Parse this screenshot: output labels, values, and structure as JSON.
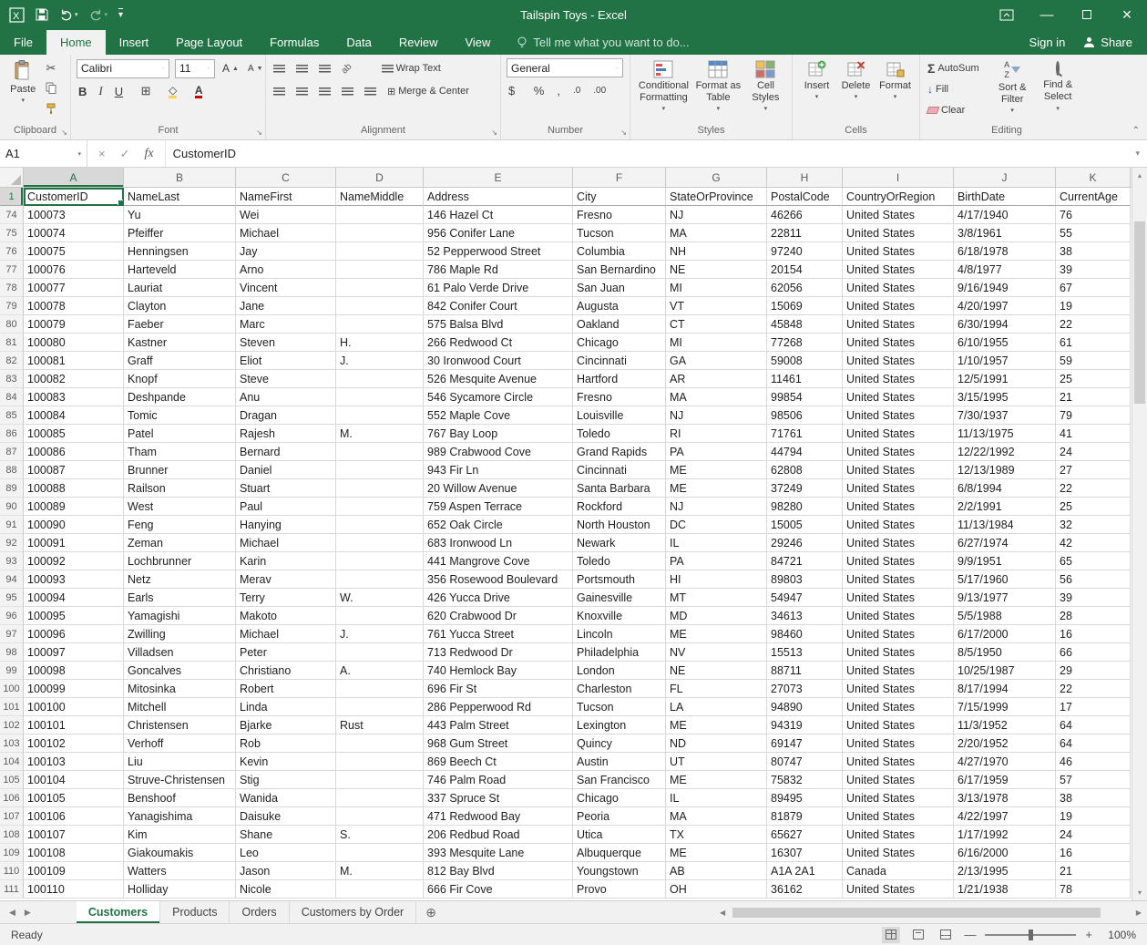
{
  "title_bar": {
    "title": "Tailspin Toys - Excel"
  },
  "ribbon": {
    "tabs": [
      {
        "label": "File",
        "active": false
      },
      {
        "label": "Home",
        "active": true
      },
      {
        "label": "Insert",
        "active": false
      },
      {
        "label": "Page Layout",
        "active": false
      },
      {
        "label": "Formulas",
        "active": false
      },
      {
        "label": "Data",
        "active": false
      },
      {
        "label": "Review",
        "active": false
      },
      {
        "label": "View",
        "active": false
      }
    ],
    "tell_me": "Tell me what you want to do...",
    "sign_in": "Sign in",
    "share": "Share",
    "clipboard": {
      "label": "Clipboard",
      "paste": "Paste"
    },
    "font": {
      "label": "Font",
      "font_name": "Calibri",
      "font_size": "11",
      "bold": "B",
      "italic": "I",
      "underline": "U",
      "grow": "A",
      "shrink": "A",
      "color_label": "A"
    },
    "alignment": {
      "label": "Alignment",
      "wrap_text": "Wrap Text",
      "merge_center": "Merge & Center"
    },
    "number": {
      "label": "Number",
      "format": "General",
      "currency": "$",
      "percent": "%",
      "comma": ",",
      "inc_decimal": ".0",
      "dec_decimal": ".00"
    },
    "styles": {
      "label": "Styles",
      "conditional": "Conditional Formatting",
      "format_table": "Format as Table",
      "cell_styles": "Cell Styles"
    },
    "cells": {
      "label": "Cells",
      "insert": "Insert",
      "delete": "Delete",
      "format": "Format"
    },
    "editing": {
      "label": "Editing",
      "autosum": "AutoSum",
      "fill": "Fill",
      "clear": "Clear",
      "sort": "Sort & Filter",
      "find": "Find & Select"
    }
  },
  "formula_bar": {
    "name_box": "A1",
    "formula": "CustomerID",
    "fx": "fx"
  },
  "grid": {
    "columns": [
      "A",
      "B",
      "C",
      "D",
      "E",
      "F",
      "G",
      "H",
      "I",
      "J",
      "K"
    ],
    "header_row": {
      "n": "1",
      "cells": [
        "CustomerID",
        "NameLast",
        "NameFirst",
        "NameMiddle",
        "Address",
        "City",
        "StateOrProvince",
        "PostalCode",
        "CountryOrRegion",
        "BirthDate",
        "CurrentAge"
      ]
    },
    "rows": [
      {
        "n": "74",
        "cells": [
          "100073",
          "Yu",
          "Wei",
          "",
          "146 Hazel Ct",
          "Fresno",
          "NJ",
          "46266",
          "United States",
          "4/17/1940",
          "76"
        ]
      },
      {
        "n": "75",
        "cells": [
          "100074",
          "Pfeiffer",
          "Michael",
          "",
          "956 Conifer Lane",
          "Tucson",
          "MA",
          "22811",
          "United States",
          "3/8/1961",
          "55"
        ]
      },
      {
        "n": "76",
        "cells": [
          "100075",
          "Henningsen",
          "Jay",
          "",
          "52 Pepperwood Street",
          "Columbia",
          "NH",
          "97240",
          "United States",
          "6/18/1978",
          "38"
        ]
      },
      {
        "n": "77",
        "cells": [
          "100076",
          "Harteveld",
          "Arno",
          "",
          "786 Maple Rd",
          "San Bernardino",
          "NE",
          "20154",
          "United States",
          "4/8/1977",
          "39"
        ]
      },
      {
        "n": "78",
        "cells": [
          "100077",
          "Lauriat",
          "Vincent",
          "",
          "61 Palo Verde Drive",
          "San Juan",
          "MI",
          "62056",
          "United States",
          "9/16/1949",
          "67"
        ]
      },
      {
        "n": "79",
        "cells": [
          "100078",
          "Clayton",
          "Jane",
          "",
          "842 Conifer Court",
          "Augusta",
          "VT",
          "15069",
          "United States",
          "4/20/1997",
          "19"
        ]
      },
      {
        "n": "80",
        "cells": [
          "100079",
          "Faeber",
          "Marc",
          "",
          "575 Balsa Blvd",
          "Oakland",
          "CT",
          "45848",
          "United States",
          "6/30/1994",
          "22"
        ]
      },
      {
        "n": "81",
        "cells": [
          "100080",
          "Kastner",
          "Steven",
          "H.",
          "266 Redwood Ct",
          "Chicago",
          "MI",
          "77268",
          "United States",
          "6/10/1955",
          "61"
        ]
      },
      {
        "n": "82",
        "cells": [
          "100081",
          "Graff",
          "Eliot",
          "J.",
          "30 Ironwood Court",
          "Cincinnati",
          "GA",
          "59008",
          "United States",
          "1/10/1957",
          "59"
        ]
      },
      {
        "n": "83",
        "cells": [
          "100082",
          "Knopf",
          "Steve",
          "",
          "526 Mesquite Avenue",
          "Hartford",
          "AR",
          "11461",
          "United States",
          "12/5/1991",
          "25"
        ]
      },
      {
        "n": "84",
        "cells": [
          "100083",
          "Deshpande",
          "Anu",
          "",
          "546 Sycamore Circle",
          "Fresno",
          "MA",
          "99854",
          "United States",
          "3/15/1995",
          "21"
        ]
      },
      {
        "n": "85",
        "cells": [
          "100084",
          "Tomic",
          "Dragan",
          "",
          "552 Maple Cove",
          "Louisville",
          "NJ",
          "98506",
          "United States",
          "7/30/1937",
          "79"
        ]
      },
      {
        "n": "86",
        "cells": [
          "100085",
          "Patel",
          "Rajesh",
          "M.",
          "767 Bay Loop",
          "Toledo",
          "RI",
          "71761",
          "United States",
          "11/13/1975",
          "41"
        ]
      },
      {
        "n": "87",
        "cells": [
          "100086",
          "Tham",
          "Bernard",
          "",
          "989 Crabwood Cove",
          "Grand Rapids",
          "PA",
          "44794",
          "United States",
          "12/22/1992",
          "24"
        ]
      },
      {
        "n": "88",
        "cells": [
          "100087",
          "Brunner",
          "Daniel",
          "",
          "943 Fir Ln",
          "Cincinnati",
          "ME",
          "62808",
          "United States",
          "12/13/1989",
          "27"
        ]
      },
      {
        "n": "89",
        "cells": [
          "100088",
          "Railson",
          "Stuart",
          "",
          "20 Willow Avenue",
          "Santa Barbara",
          "ME",
          "37249",
          "United States",
          "6/8/1994",
          "22"
        ]
      },
      {
        "n": "90",
        "cells": [
          "100089",
          "West",
          "Paul",
          "",
          "759 Aspen Terrace",
          "Rockford",
          "NJ",
          "98280",
          "United States",
          "2/2/1991",
          "25"
        ]
      },
      {
        "n": "91",
        "cells": [
          "100090",
          "Feng",
          "Hanying",
          "",
          "652 Oak Circle",
          "North Houston",
          "DC",
          "15005",
          "United States",
          "11/13/1984",
          "32"
        ]
      },
      {
        "n": "92",
        "cells": [
          "100091",
          "Zeman",
          "Michael",
          "",
          "683 Ironwood Ln",
          "Newark",
          "IL",
          "29246",
          "United States",
          "6/27/1974",
          "42"
        ]
      },
      {
        "n": "93",
        "cells": [
          "100092",
          "Lochbrunner",
          "Karin",
          "",
          "441 Mangrove Cove",
          "Toledo",
          "PA",
          "84721",
          "United States",
          "9/9/1951",
          "65"
        ]
      },
      {
        "n": "94",
        "cells": [
          "100093",
          "Netz",
          "Merav",
          "",
          "356 Rosewood Boulevard",
          "Portsmouth",
          "HI",
          "89803",
          "United States",
          "5/17/1960",
          "56"
        ]
      },
      {
        "n": "95",
        "cells": [
          "100094",
          "Earls",
          "Terry",
          "W.",
          "426 Yucca Drive",
          "Gainesville",
          "MT",
          "54947",
          "United States",
          "9/13/1977",
          "39"
        ]
      },
      {
        "n": "96",
        "cells": [
          "100095",
          "Yamagishi",
          "Makoto",
          "",
          "620 Crabwood Dr",
          "Knoxville",
          "MD",
          "34613",
          "United States",
          "5/5/1988",
          "28"
        ]
      },
      {
        "n": "97",
        "cells": [
          "100096",
          "Zwilling",
          "Michael",
          "J.",
          "761 Yucca Street",
          "Lincoln",
          "ME",
          "98460",
          "United States",
          "6/17/2000",
          "16"
        ]
      },
      {
        "n": "98",
        "cells": [
          "100097",
          "Villadsen",
          "Peter",
          "",
          "713 Redwood Dr",
          "Philadelphia",
          "NV",
          "15513",
          "United States",
          "8/5/1950",
          "66"
        ]
      },
      {
        "n": "99",
        "cells": [
          "100098",
          "Goncalves",
          "Christiano",
          "A.",
          "740 Hemlock Bay",
          "London",
          "NE",
          "88711",
          "United States",
          "10/25/1987",
          "29"
        ]
      },
      {
        "n": "100",
        "cells": [
          "100099",
          "Mitosinka",
          "Robert",
          "",
          "696 Fir St",
          "Charleston",
          "FL",
          "27073",
          "United States",
          "8/17/1994",
          "22"
        ]
      },
      {
        "n": "101",
        "cells": [
          "100100",
          "Mitchell",
          "Linda",
          "",
          "286 Pepperwood Rd",
          "Tucson",
          "LA",
          "94890",
          "United States",
          "7/15/1999",
          "17"
        ]
      },
      {
        "n": "102",
        "cells": [
          "100101",
          "Christensen",
          "Bjarke",
          "Rust",
          "443 Palm Street",
          "Lexington",
          "ME",
          "94319",
          "United States",
          "11/3/1952",
          "64"
        ]
      },
      {
        "n": "103",
        "cells": [
          "100102",
          "Verhoff",
          "Rob",
          "",
          "968 Gum Street",
          "Quincy",
          "ND",
          "69147",
          "United States",
          "2/20/1952",
          "64"
        ]
      },
      {
        "n": "104",
        "cells": [
          "100103",
          "Liu",
          "Kevin",
          "",
          "869 Beech Ct",
          "Austin",
          "UT",
          "80747",
          "United States",
          "4/27/1970",
          "46"
        ]
      },
      {
        "n": "105",
        "cells": [
          "100104",
          "Struve-Christensen",
          "Stig",
          "",
          "746 Palm Road",
          "San Francisco",
          "ME",
          "75832",
          "United States",
          "6/17/1959",
          "57"
        ]
      },
      {
        "n": "106",
        "cells": [
          "100105",
          "Benshoof",
          "Wanida",
          "",
          "337 Spruce St",
          "Chicago",
          "IL",
          "89495",
          "United States",
          "3/13/1978",
          "38"
        ]
      },
      {
        "n": "107",
        "cells": [
          "100106",
          "Yanagishima",
          "Daisuke",
          "",
          "471 Redwood Bay",
          "Peoria",
          "MA",
          "81879",
          "United States",
          "4/22/1997",
          "19"
        ]
      },
      {
        "n": "108",
        "cells": [
          "100107",
          "Kim",
          "Shane",
          "S.",
          "206 Redbud Road",
          "Utica",
          "TX",
          "65627",
          "United States",
          "1/17/1992",
          "24"
        ]
      },
      {
        "n": "109",
        "cells": [
          "100108",
          "Giakoumakis",
          "Leo",
          "",
          "393 Mesquite Lane",
          "Albuquerque",
          "ME",
          "16307",
          "United States",
          "6/16/2000",
          "16"
        ]
      },
      {
        "n": "110",
        "cells": [
          "100109",
          "Watters",
          "Jason",
          "M.",
          "812 Bay Blvd",
          "Youngstown",
          "AB",
          "A1A 2A1",
          "Canada",
          "2/13/1995",
          "21"
        ]
      },
      {
        "n": "111",
        "cells": [
          "100110",
          "Holliday",
          "Nicole",
          "",
          "666 Fir Cove",
          "Provo",
          "OH",
          "36162",
          "United States",
          "1/21/1938",
          "78"
        ]
      }
    ]
  },
  "sheet_tabs": {
    "tabs": [
      {
        "label": "Customers",
        "active": true
      },
      {
        "label": "Products",
        "active": false
      },
      {
        "label": "Orders",
        "active": false
      },
      {
        "label": "Customers by Order",
        "active": false
      }
    ]
  },
  "status_bar": {
    "ready": "Ready",
    "zoom": "100%"
  }
}
